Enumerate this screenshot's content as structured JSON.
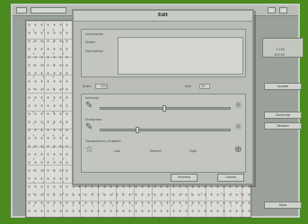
{
  "dialog": {
    "title": "Edit",
    "top_group": {
      "labels": [
        "Information",
        "Status",
        "Description"
      ]
    },
    "color_row": {
      "left_label": "Scale",
      "left_value": "100",
      "right_label": "Size",
      "right_value": "10"
    },
    "section1_label": "Intensity",
    "section2_label": "Sharpness",
    "section3_label": "Transparency of object",
    "options": [
      "Low",
      "Normal",
      "High"
    ],
    "buttons": {
      "ok": "Preview",
      "cancel": "Cancel"
    }
  },
  "right_panel": {
    "box_value": "1:250",
    "box_value2": "100.00",
    "buttons": [
      "Update",
      "Generate",
      "Restore",
      "Save"
    ]
  },
  "colors": {
    "background": "#4a8a1e",
    "frame": "#9aa09a"
  }
}
